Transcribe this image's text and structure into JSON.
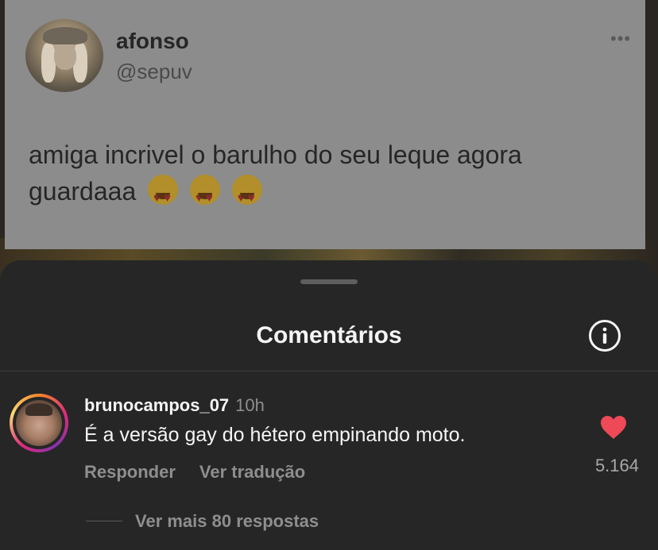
{
  "tweet": {
    "display_name": "afonso",
    "handle": "@sepuv",
    "more_label": "•••",
    "text": "amiga incrivel o barulho do seu leque agora guardaaa",
    "emoji_count": 3,
    "emoji_icon": "smiling-face-with-heart-eyes"
  },
  "sheet": {
    "title": "Comentários",
    "info_icon": "info-circle-icon"
  },
  "comment": {
    "username": "brunocampos_07",
    "time": "10h",
    "text": "É a versão gay do hétero empinando moto.",
    "actions": {
      "reply": "Responder",
      "translate": "Ver tradução"
    },
    "like_count": "5.164",
    "liked": true,
    "like_color": "#ed4956",
    "view_replies": "Ver mais 80 respostas"
  }
}
